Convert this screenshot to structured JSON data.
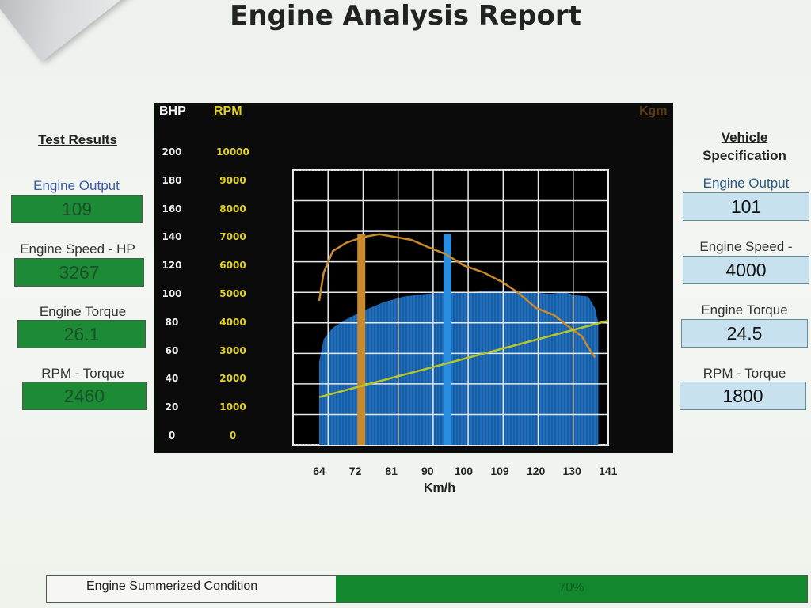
{
  "report": {
    "title": "Engine Analysis Report"
  },
  "test_results": {
    "heading": "Test Results",
    "fields": [
      {
        "label": "Engine Output",
        "value": "109"
      },
      {
        "label": "Engine Speed - HP",
        "value": "3267"
      },
      {
        "label": "Engine Torque",
        "value": "26.1"
      },
      {
        "label": "RPM - Torque",
        "value": "2460"
      }
    ]
  },
  "vehicle_spec": {
    "heading_line1": "Vehicle",
    "heading_line2": "Specification",
    "fields": [
      {
        "label": "Engine Output",
        "value": "101"
      },
      {
        "label": "Engine Speed -",
        "value": "4000"
      },
      {
        "label": "Engine Torque",
        "value": "24.5"
      },
      {
        "label": "RPM - Torque",
        "value": "1800"
      }
    ]
  },
  "chart": {
    "bhp_label": "BHP",
    "rpm_label": "RPM",
    "kgm_label": "Kgm",
    "bhp_ticks": [
      "200",
      "180",
      "160",
      "140",
      "120",
      "100",
      "80",
      "60",
      "40",
      "20",
      "0"
    ],
    "rpm_ticks": [
      "10000",
      "9000",
      "8000",
      "7000",
      "6000",
      "5000",
      "4000",
      "3000",
      "2000",
      "1000",
      "0"
    ],
    "x_ticks": [
      "64",
      "72",
      "81",
      "90",
      "100",
      "109",
      "120",
      "130",
      "141"
    ],
    "x_label": "Km/h"
  },
  "chart_data": {
    "type": "line",
    "x_unit": "Km/h",
    "x_ticks": [
      64,
      72,
      81,
      90,
      100,
      109,
      120,
      130,
      141
    ],
    "bhp_range": [
      0,
      200
    ],
    "rpm_range": [
      0,
      10000
    ],
    "grid": true,
    "series": [
      {
        "kind": "area",
        "axis": "rpm",
        "color": "#1f6fc0",
        "x": [
          64,
          65,
          67,
          70,
          74,
          79,
          84,
          90,
          95,
          100,
          106,
          112,
          118,
          124,
          128,
          131,
          135,
          137,
          138
        ],
        "y": [
          2600,
          3400,
          3800,
          4100,
          4400,
          4700,
          4900,
          5000,
          5050,
          5050,
          5100,
          5100,
          5050,
          5000,
          5050,
          4950,
          4900,
          4500,
          4000
        ]
      },
      {
        "axis": "bhp",
        "color": "#c88a2c",
        "x": [
          64,
          65,
          67,
          70,
          74,
          78,
          82,
          86,
          90,
          95,
          100,
          105,
          110,
          115,
          120,
          125,
          130,
          133,
          135,
          137
        ],
        "y": [
          95,
          115,
          130,
          136,
          140,
          142,
          140,
          138,
          133,
          128,
          120,
          115,
          108,
          100,
          90,
          85,
          75,
          70,
          62,
          55
        ]
      },
      {
        "axis": "rpm",
        "color": "#b7c729",
        "x": [
          64,
          141
        ],
        "y": [
          1350,
          4050
        ]
      }
    ],
    "markers": [
      {
        "x": 73.5,
        "color": "#c88a2c"
      },
      {
        "x": 95.5,
        "color": "#2a8ee0"
      }
    ]
  },
  "condition": {
    "label": "Engine Summerized Condition",
    "value": "70%",
    "fill": 0.62
  }
}
